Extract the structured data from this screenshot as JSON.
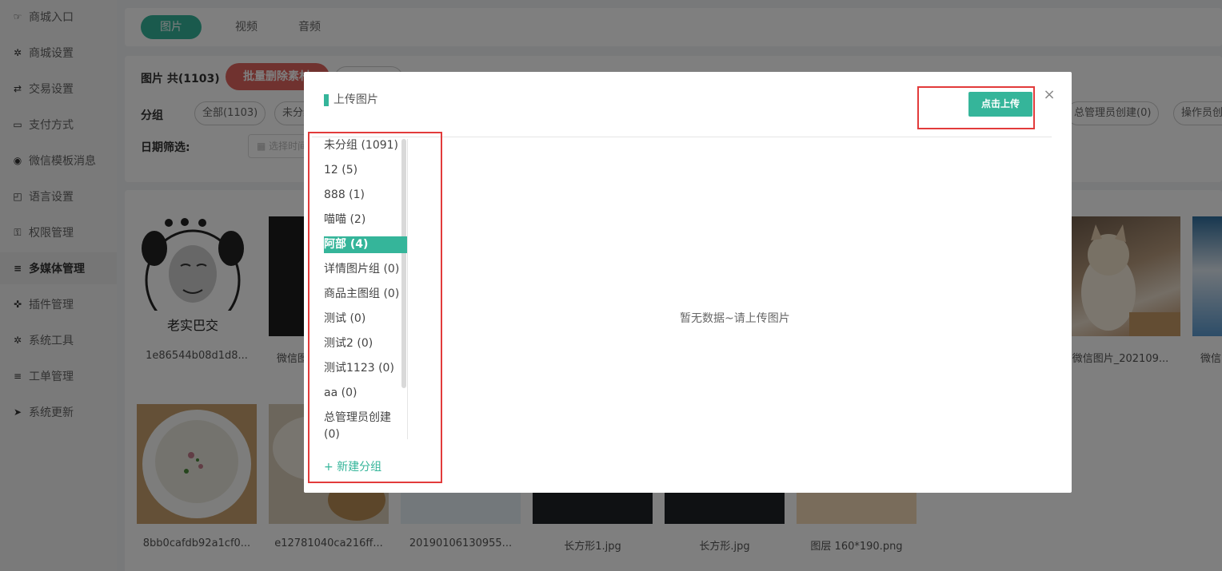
{
  "sidebar": {
    "items": [
      {
        "label": "商城入口",
        "icon": "hand-pointer-icon",
        "glyph": "☞"
      },
      {
        "label": "商城设置",
        "icon": "gear-icon",
        "glyph": "✲"
      },
      {
        "label": "交易设置",
        "icon": "exchange-icon",
        "glyph": "⇄"
      },
      {
        "label": "支付方式",
        "icon": "credit-card-icon",
        "glyph": "▭"
      },
      {
        "label": "微信模板消息",
        "icon": "wechat-icon",
        "glyph": "◉"
      },
      {
        "label": "语言设置",
        "icon": "language-icon",
        "glyph": "◰"
      },
      {
        "label": "权限管理",
        "icon": "key-icon",
        "glyph": "⚿"
      },
      {
        "label": "多媒体管理",
        "icon": "list-icon",
        "glyph": "≡"
      },
      {
        "label": "插件管理",
        "icon": "puzzle-icon",
        "glyph": "✜"
      },
      {
        "label": "系统工具",
        "icon": "gear-icon",
        "glyph": "✲"
      },
      {
        "label": "工单管理",
        "icon": "list-icon",
        "glyph": "≡"
      },
      {
        "label": "系统更新",
        "icon": "paper-plane-icon",
        "glyph": "➤"
      }
    ],
    "active_index": 7
  },
  "tabs": [
    {
      "label": "图片",
      "active": true
    },
    {
      "label": "视频",
      "active": false
    },
    {
      "label": "音频",
      "active": false
    }
  ],
  "filter": {
    "count_title": "图片 共(1103)",
    "batch_delete_label": "批量删除素材",
    "group_label": "分组",
    "chips": [
      "全部(1103)",
      "未分组",
      "总管理员创建(0)",
      "操作员创建"
    ],
    "date_label": "日期筛选:",
    "date_placeholder": "选择时间"
  },
  "gallery": {
    "row1": [
      "1e86544b08d1d8...",
      "微信图",
      "微信图片_202109...",
      "微信"
    ],
    "row2": [
      "8bb0cafdb92a1cf0...",
      "e12781040ca216ff...",
      "20190106130955...",
      "长方形1.jpg",
      "长方形.jpg",
      "图层 160*190.png"
    ],
    "meme_text": "老实巴交"
  },
  "modal": {
    "title": "上传图片",
    "upload_label": "点击上传",
    "close_glyph": "×",
    "empty_text": "暂无数据~请上传图片",
    "new_group_label": "+ 新建分组",
    "groups": [
      {
        "label": "未分组 (1091)"
      },
      {
        "label": "12 (5)"
      },
      {
        "label": "888 (1)"
      },
      {
        "label": "喵喵 (2)"
      },
      {
        "label": "阿部 (4)"
      },
      {
        "label": "详情图片组 (0)"
      },
      {
        "label": "商品主图组 (0)"
      },
      {
        "label": "测试 (0)"
      },
      {
        "label": "测试2 (0)"
      },
      {
        "label": "测试1123 (0)"
      },
      {
        "label": "aa (0)"
      },
      {
        "label": "总管理员创建"
      },
      {
        "label": "(0)"
      }
    ],
    "active_group_index": 4
  },
  "colors": {
    "accent": "#35b59a",
    "danger": "#e0655f",
    "highlight_box": "#e23b3b"
  }
}
